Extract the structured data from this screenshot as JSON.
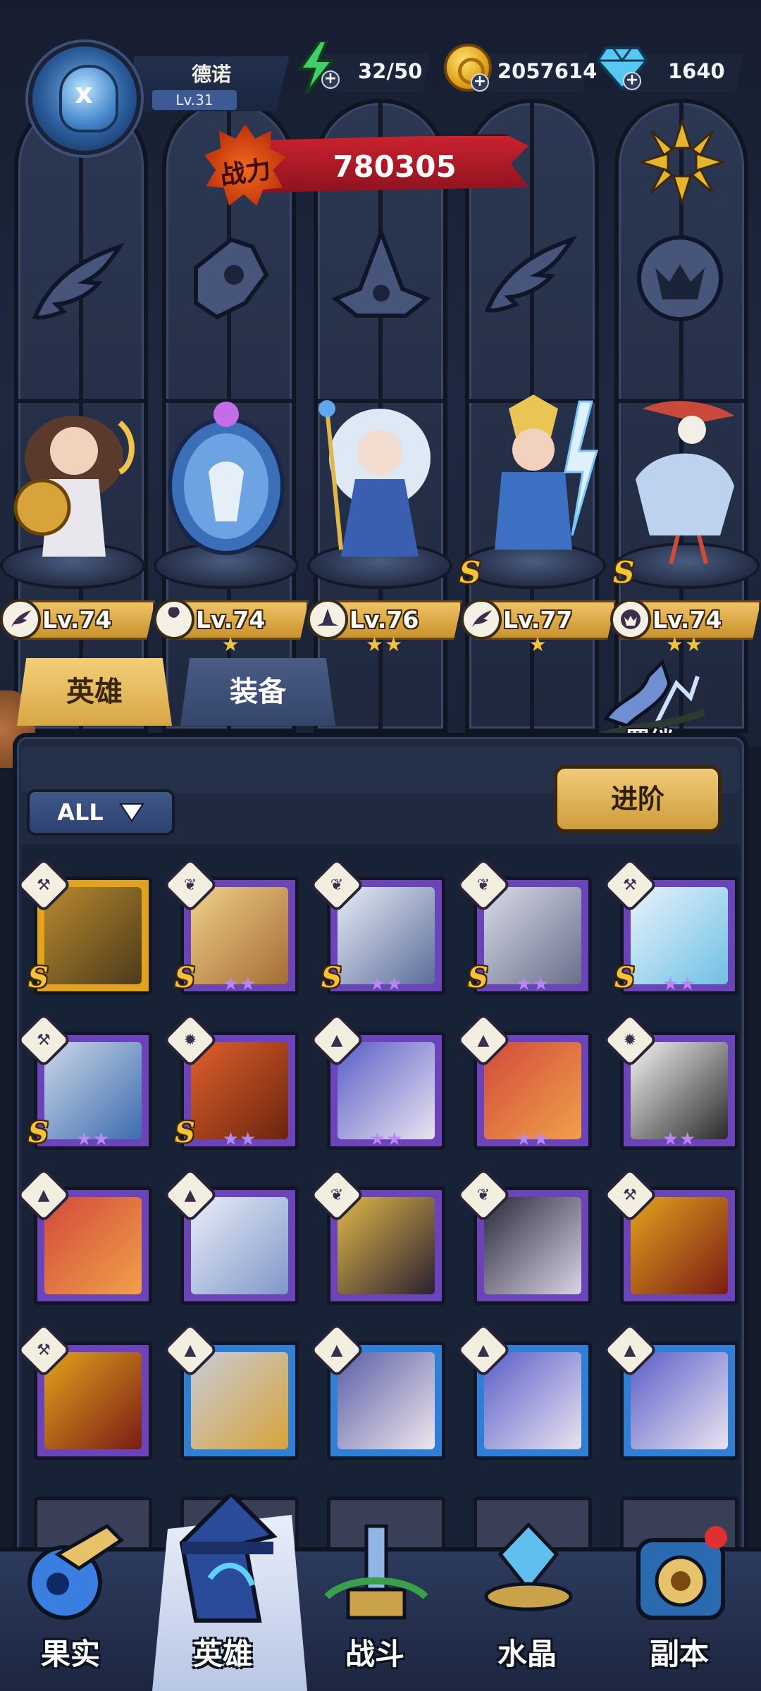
{
  "player": {
    "name": "德诺",
    "level": "Lv.31"
  },
  "resources": {
    "energy": {
      "value": "32/50",
      "icon": "energy-bolt-icon"
    },
    "gold": {
      "value": "2057614",
      "icon": "gold-coin-icon"
    },
    "gems": {
      "value": "1640",
      "icon": "diamond-icon"
    }
  },
  "power": {
    "label": "战力",
    "value": "780305"
  },
  "class_emblems": [
    "wing-emblem-icon",
    "wrench-emblem-icon",
    "wizard-hat-emblem-icon",
    "wing-emblem-icon",
    "beast-emblem-icon"
  ],
  "lineup": [
    {
      "level": "Lv.74",
      "class": "wing",
      "stars": "",
      "s_rank": false
    },
    {
      "level": "Lv.74",
      "class": "wrench",
      "stars": "★",
      "s_rank": false
    },
    {
      "level": "Lv.76",
      "class": "hat",
      "stars": "★★",
      "s_rank": false
    },
    {
      "level": "Lv.77",
      "class": "wing",
      "stars": "★",
      "s_rank": true
    },
    {
      "level": "Lv.74",
      "class": "beast",
      "stars": "★★",
      "s_rank": true
    }
  ],
  "tabs": {
    "heroes": "英雄",
    "equipment": "装备"
  },
  "bond": {
    "label": "羁绊"
  },
  "filter": {
    "label": "ALL"
  },
  "advance_button": {
    "label": "进阶"
  },
  "roster": [
    {
      "class": "wrench",
      "frame": "gold",
      "s_rank": true,
      "stars": ""
    },
    {
      "class": "wing",
      "frame": "purple",
      "s_rank": true,
      "stars": "★★"
    },
    {
      "class": "wing",
      "frame": "purple",
      "s_rank": true,
      "stars": "★★"
    },
    {
      "class": "wing",
      "frame": "purple",
      "s_rank": true,
      "stars": "★★"
    },
    {
      "class": "wrench",
      "frame": "purple",
      "s_rank": true,
      "stars": "★★"
    },
    {
      "class": "wrench",
      "frame": "purple",
      "s_rank": true,
      "stars": "★★"
    },
    {
      "class": "beast",
      "frame": "purple",
      "s_rank": true,
      "stars": "★★"
    },
    {
      "class": "hat",
      "frame": "purple",
      "s_rank": false,
      "stars": "★★"
    },
    {
      "class": "hat",
      "frame": "purple",
      "s_rank": false,
      "stars": "★★"
    },
    {
      "class": "beast",
      "frame": "purple",
      "s_rank": false,
      "stars": "★★"
    },
    {
      "class": "hat",
      "frame": "purple",
      "s_rank": false,
      "stars": ""
    },
    {
      "class": "hat",
      "frame": "purple",
      "s_rank": false,
      "stars": ""
    },
    {
      "class": "wing",
      "frame": "purple",
      "s_rank": false,
      "stars": ""
    },
    {
      "class": "wing",
      "frame": "purple",
      "s_rank": false,
      "stars": ""
    },
    {
      "class": "wrench",
      "frame": "purple",
      "s_rank": false,
      "stars": ""
    },
    {
      "class": "wrench",
      "frame": "purple",
      "s_rank": false,
      "stars": ""
    },
    {
      "class": "hat",
      "frame": "blue",
      "s_rank": false,
      "stars": ""
    },
    {
      "class": "hat",
      "frame": "blue",
      "s_rank": false,
      "stars": ""
    },
    {
      "class": "hat",
      "frame": "blue",
      "s_rank": false,
      "stars": ""
    },
    {
      "class": "hat",
      "frame": "blue",
      "s_rank": false,
      "stars": ""
    }
  ],
  "bottom_nav": [
    {
      "label": "果实",
      "icon": "fruit-nav-icon",
      "active": false
    },
    {
      "label": "英雄",
      "icon": "hero-nav-icon",
      "active": true
    },
    {
      "label": "战斗",
      "icon": "battle-nav-icon",
      "active": false
    },
    {
      "label": "水晶",
      "icon": "crystal-nav-icon",
      "active": false
    },
    {
      "label": "副本",
      "icon": "dungeon-nav-icon",
      "active": false
    }
  ],
  "colors": {
    "gold_accent": "#d8a746",
    "power_red": "#c9222d",
    "frame_purple": "#6a44b8",
    "frame_blue": "#2f7fd6",
    "frame_gold": "#e2a31d"
  }
}
